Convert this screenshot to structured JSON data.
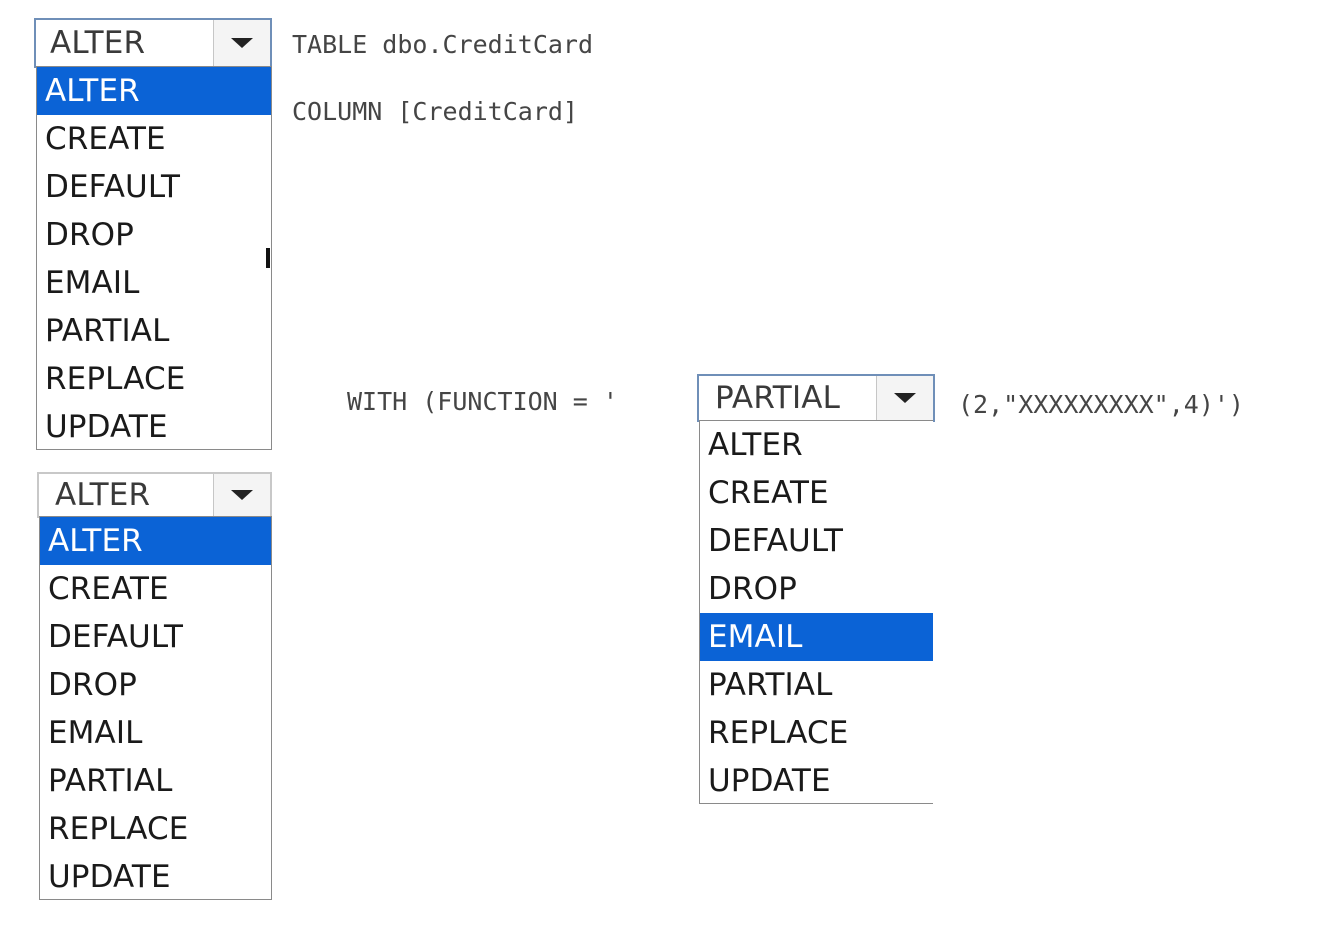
{
  "options": [
    "ALTER",
    "CREATE",
    "DEFAULT",
    "DROP",
    "EMAIL",
    "PARTIAL",
    "REPLACE",
    "UPDATE"
  ],
  "dropdown1": {
    "selected": "ALTER",
    "highlighted": "ALTER"
  },
  "dropdown2": {
    "selected": "ALTER",
    "highlighted": "ALTER"
  },
  "dropdown3": {
    "selected": "PARTIAL",
    "highlighted": "EMAIL"
  },
  "code": {
    "line1": "TABLE dbo.CreditCard",
    "line2": "COLUMN [CreditCard]",
    "with_prefix": "WITH (FUNCTION = '",
    "with_suffix": "(2,\"XXXXXXXXX\",4)')"
  },
  "icons": {
    "dropdown_arrow": "chevron-down-icon"
  }
}
